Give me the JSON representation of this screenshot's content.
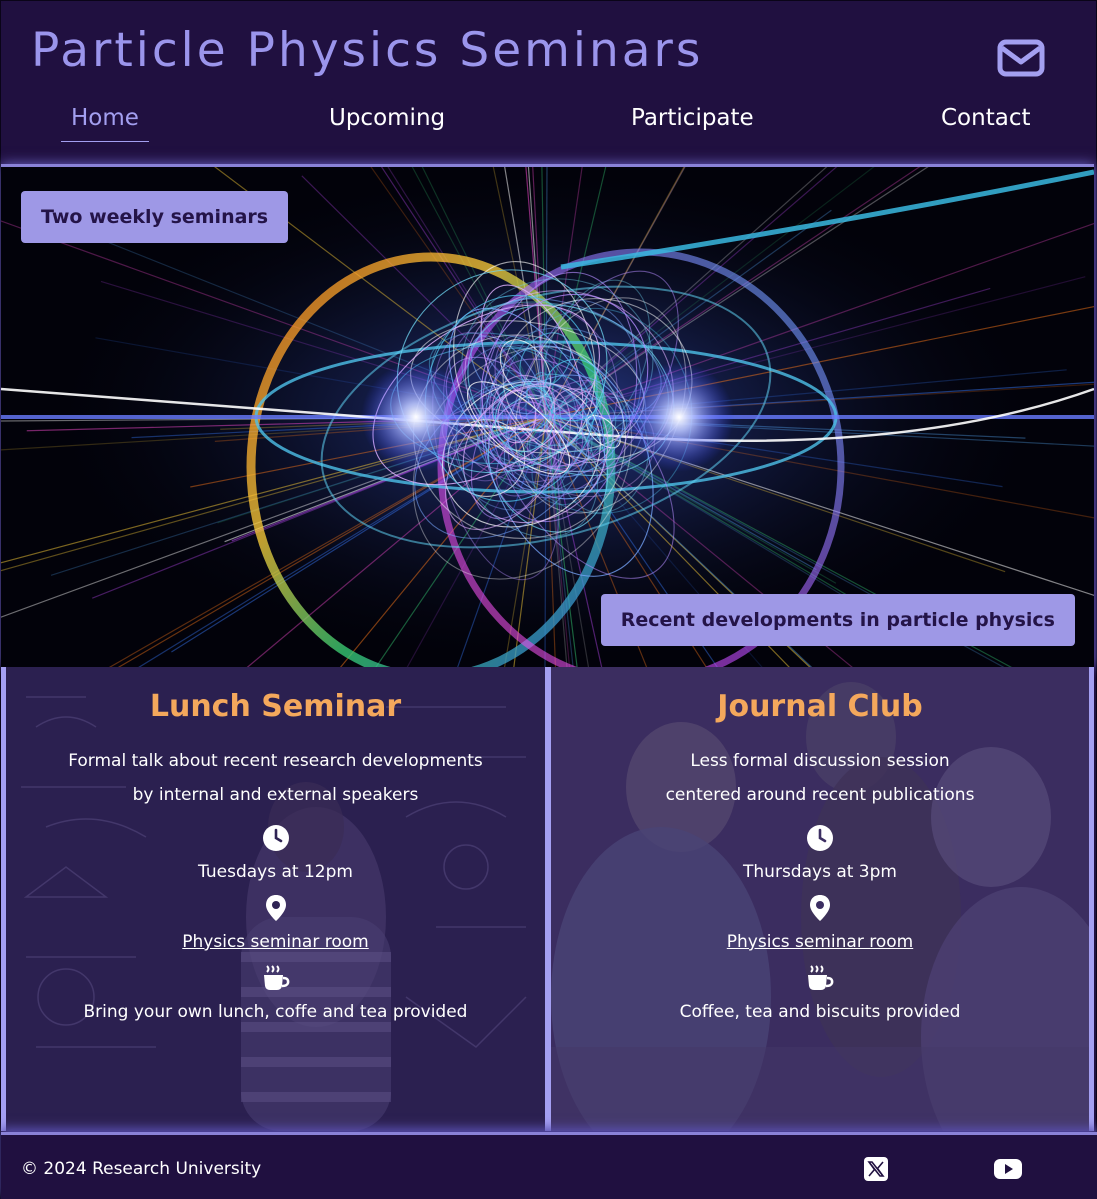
{
  "header": {
    "title": "Particle Physics Seminars",
    "mail_icon": "envelope-icon"
  },
  "nav": {
    "items": [
      {
        "label": "Home",
        "active": true
      },
      {
        "label": "Upcoming",
        "active": false
      },
      {
        "label": "Participate",
        "active": false
      },
      {
        "label": "Contact",
        "active": false
      }
    ]
  },
  "hero": {
    "tag_top": "Two weekly seminars",
    "tag_bottom": "Recent developments in particle physics"
  },
  "cards": [
    {
      "title": "Lunch Seminar",
      "desc_line1": "Formal talk about recent research developments",
      "desc_line2": "by internal and external speakers",
      "time": "Tuesdays at 12pm",
      "location": "Physics seminar room",
      "catering": "Bring your own lunch, coffe and tea provided"
    },
    {
      "title": "Journal Club",
      "desc_line1": "Less formal discussion session",
      "desc_line2": "centered around recent publications",
      "time": "Thursdays at 3pm",
      "location": "Physics seminar room",
      "catering": "Coffee, tea and biscuits provided"
    }
  ],
  "footer": {
    "copyright": "© 2024 Research University",
    "social": [
      "x-logo-icon",
      "youtube-icon"
    ]
  },
  "colors": {
    "background": "#201040",
    "accent": "#9b95ec",
    "card_title": "#f4a85c",
    "tag_bg": "#9e98e6"
  }
}
